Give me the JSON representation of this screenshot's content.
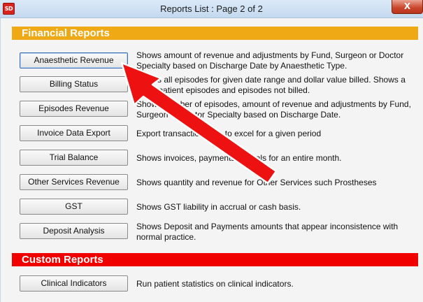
{
  "window": {
    "title": "Reports List : Page 2 of 2",
    "app_icon_text": "SD",
    "close_label": "X"
  },
  "sections": {
    "financial": {
      "title": "Financial Reports",
      "color": "#eea915",
      "items": [
        {
          "label": "Anaesthetic Revenue",
          "desc": "Shows amount of revenue and adjustments by Fund, Surgeon or Doctor Specialty based on Discharge Date by Anaesthetic Type."
        },
        {
          "label": "Billing Status",
          "desc": "Shows all episodes for given date range and dollar value billed. Shows a list of patient episodes and episodes not billed."
        },
        {
          "label": "Episodes Revenue",
          "desc": "Shows number of episodes, amount of revenue and adjustments by Fund, Surgeon or Doctor Specialty based on Discharge Date."
        },
        {
          "label": "Invoice Data Export",
          "desc": "Export transaction data to excel for a given period"
        },
        {
          "label": "Trial Balance",
          "desc": "Shows invoices, payments, jounals for an entire month."
        },
        {
          "label": "Other Services Revenue",
          "desc": "Shows quantity and revenue for Other Services such Prostheses"
        },
        {
          "label": "GST",
          "desc": "Shows GST liability in accrual or cash basis."
        },
        {
          "label": "Deposit Analysis",
          "desc": "Shows Deposit and Payments amounts that appear inconsistence with normal practice."
        }
      ]
    },
    "custom": {
      "title": "Custom Reports",
      "color": "#f10000",
      "items": [
        {
          "label": "Clinical Indicators",
          "desc": "Run patient statistics on clinical indicators."
        }
      ]
    }
  },
  "annotation": {
    "arrow_color": "#ee1111",
    "points_to": "Anaesthetic Revenue"
  }
}
